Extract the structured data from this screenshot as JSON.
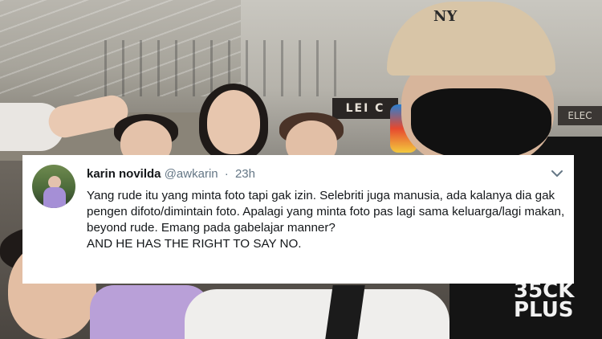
{
  "store_sign": "LEI C",
  "store_sign_2": "ELEC",
  "shirt_print": [
    "35CK",
    "PLUS"
  ],
  "cap_logo": "NY",
  "tweet": {
    "display_name": "karin novilda",
    "handle": "@awkarin",
    "separator": "·",
    "time": "23h",
    "text_line_1": "Yang rude itu yang minta foto tapi gak izin. Selebriti juga manusia, ada kalanya dia gak pengen difoto/dimintain foto. Apalagi yang minta foto pas lagi sama keluarga/lagi makan, beyond rude. Emang pada gabelajar manner?",
    "text_line_2": "AND HE HAS THE RIGHT TO SAY NO.",
    "menu_icon": "chevron-down-icon"
  },
  "colors": {
    "card_bg": "#ffffff",
    "text_primary": "#14171a",
    "text_secondary": "#657786"
  }
}
